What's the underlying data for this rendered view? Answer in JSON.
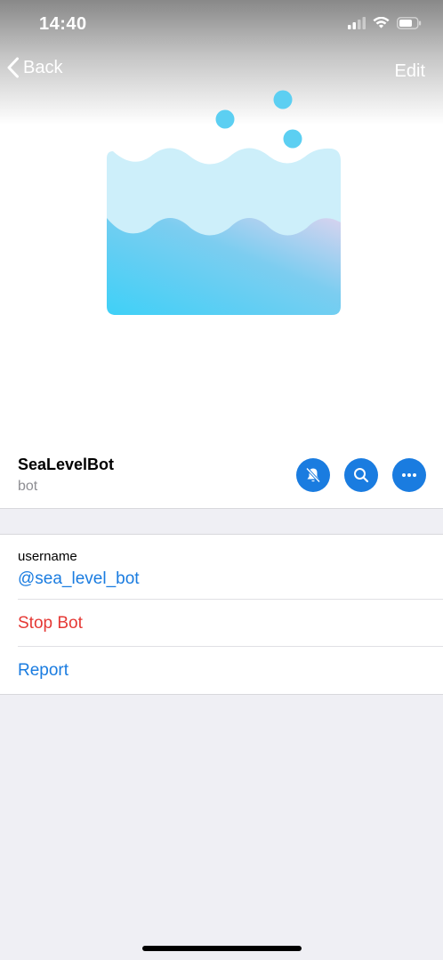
{
  "status_bar": {
    "time": "14:40",
    "signal_icon": "signal-icon",
    "wifi_icon": "wifi-icon",
    "battery_icon": "battery-icon"
  },
  "nav": {
    "back_label": "Back",
    "edit_label": "Edit"
  },
  "profile": {
    "name": "SeaLevelBot",
    "type": "bot",
    "avatar_icon": "sea-level-wave-icon"
  },
  "actions": [
    {
      "name": "mute-notifications-button",
      "icon": "bell-slash-icon"
    },
    {
      "name": "search-button",
      "icon": "search-icon"
    },
    {
      "name": "more-button",
      "icon": "ellipsis-icon"
    }
  ],
  "details": {
    "username_label": "username",
    "username_value": "@sea_level_bot",
    "stop_bot_label": "Stop Bot",
    "report_label": "Report"
  },
  "colors": {
    "accent": "#1a7ce0",
    "destructive": "#e53935",
    "background": "#efeff4"
  }
}
